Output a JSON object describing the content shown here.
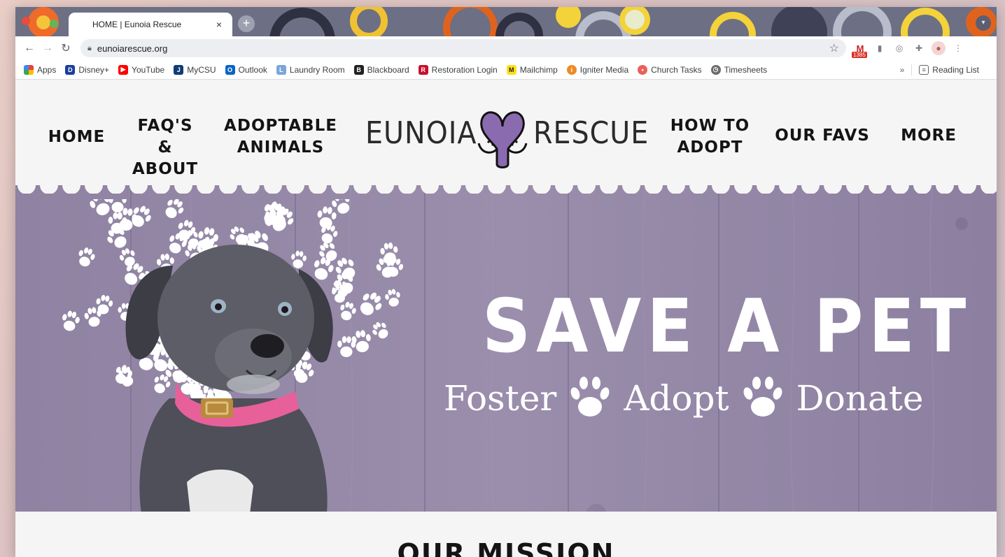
{
  "browser": {
    "tab_title": "HOME | Eunoia Rescue",
    "tab_close": "×",
    "new_tab": "+",
    "url": "eunoiarescue.org",
    "gmail_badge": "1385",
    "bookmarks": [
      {
        "label": "Apps",
        "icon": "apps-grid-icon",
        "color": "#4285f4"
      },
      {
        "label": "Disney+",
        "icon": "disney-icon",
        "color": "#1a3e9c"
      },
      {
        "label": "YouTube",
        "icon": "youtube-icon",
        "color": "#ff0000"
      },
      {
        "label": "MyCSU",
        "icon": "mycsu-icon",
        "color": "#0f3a78"
      },
      {
        "label": "Outlook",
        "icon": "outlook-icon",
        "color": "#0a64c8"
      },
      {
        "label": "Laundry Room",
        "icon": "laundry-icon",
        "color": "#7aa7d8"
      },
      {
        "label": "Blackboard",
        "icon": "blackboard-icon",
        "color": "#222222"
      },
      {
        "label": "Restoration Login",
        "icon": "restoration-icon",
        "color": "#c8102e"
      },
      {
        "label": "Mailchimp",
        "icon": "mailchimp-icon",
        "color": "#ffe01b"
      },
      {
        "label": "Igniter Media",
        "icon": "igniter-icon",
        "color": "#f08a24"
      },
      {
        "label": "Church Tasks",
        "icon": "church-tasks-icon",
        "color": "#e8615a"
      },
      {
        "label": "Timesheets",
        "icon": "timesheets-icon",
        "color": "#6b6b6b"
      }
    ],
    "reading_list": "Reading List",
    "overflow": "»"
  },
  "site": {
    "nav": {
      "home": "HOME",
      "faq_line1": "FAQ'S",
      "faq_line2": "& ABOUT",
      "adopt_line1": "ADOPTABLE",
      "adopt_line2": "ANIMALS",
      "howto_line1": "HOW TO",
      "howto_line2": "ADOPT",
      "favs": "OUR FAVS",
      "more": "MORE"
    },
    "logo": {
      "left": "EUNOIA",
      "right": "RESCUE"
    },
    "hero": {
      "title": "SAVE A PET",
      "words": [
        "Foster",
        "Adopt",
        "Donate"
      ]
    },
    "mission_title": "OUR MISSION"
  },
  "colors": {
    "hero_purple": "#9487a6",
    "logo_purple": "#8a6bb0",
    "collar_pink": "#e8609a"
  }
}
